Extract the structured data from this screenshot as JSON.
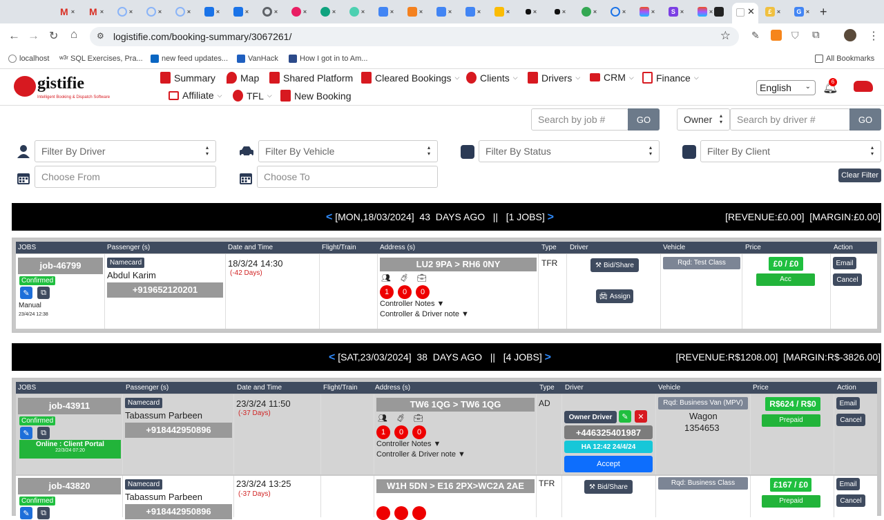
{
  "browser": {
    "url": "logistifie.com/booking-summary/3067261/",
    "bookmarks": [
      {
        "label": "localhost"
      },
      {
        "label": "SQL Exercises, Pra..."
      },
      {
        "label": "new feed updates..."
      },
      {
        "label": "VanHack"
      },
      {
        "label": "How I got in to Am..."
      }
    ],
    "all_bookmarks": "All Bookmarks"
  },
  "header": {
    "logo_text": "gistifie",
    "logo_tagline": "Intelligent Booking & Dispatch Software",
    "nav": [
      {
        "label": "Summary"
      },
      {
        "label": "Map"
      },
      {
        "label": "Shared Platform"
      },
      {
        "label": "Cleared Bookings"
      },
      {
        "label": "Clients"
      },
      {
        "label": "Drivers"
      },
      {
        "label": "CRM"
      },
      {
        "label": "Finance"
      },
      {
        "label": "Affiliate"
      },
      {
        "label": "TFL"
      },
      {
        "label": "New Booking"
      }
    ],
    "language": "English",
    "notification_count": "6"
  },
  "search": {
    "job_placeholder": "Search by job #",
    "go": "GO",
    "owner": "Owner",
    "driver_placeholder": "Search by driver #"
  },
  "filters": {
    "driver": "Filter By Driver",
    "vehicle": "Filter By Vehicle",
    "status": "Filter By Status",
    "client": "Filter By Client",
    "from": "Choose From",
    "to": "Choose To",
    "clear": "Clear Filter"
  },
  "columns1": {
    "jobs": "JOBS",
    "passenger": "Passenger (s)",
    "datetime": "Date and Time",
    "flight": "Flight/Train",
    "address": "Address (s)",
    "type": "Type",
    "driver": "Driver",
    "vehicle": "Vehicle",
    "price": "Price",
    "action": "Action"
  },
  "groups": [
    {
      "date": "[MON,18/03/2024]",
      "ago": "43  DAYS AGO",
      "sep": "||",
      "jobs": "[1 JOBS]",
      "revenue": "[REVENUE:£0.00]",
      "margin": "[MARGIN:£0.00]"
    },
    {
      "date": "[SAT,23/03/2024]",
      "ago": "38  DAYS AGO",
      "sep": "||",
      "jobs": "[4 JOBS]",
      "revenue": "[REVENUE:R$1208.00]",
      "margin": "[MARGIN:R$-3826.00]"
    }
  ],
  "jobs": [
    {
      "id": "job-46799",
      "status": "Confirmed",
      "source": "Manual",
      "created": "23/4/24 12:38",
      "namecard": "Namecard",
      "passenger": "Abdul Karim",
      "phone": "+919652120201",
      "datetime": "18/3/24 14:30",
      "days": "(-42 Days)",
      "address": "LU2 9PA > RH6 0NY",
      "counts": [
        "1",
        "0",
        "0"
      ],
      "notes1": "Controller Notes ▼",
      "notes2": "Controller & Driver note ▼",
      "type": "TFR",
      "bid": "Bid/Share",
      "assign": "Assign",
      "vehicle": "Rqd: Test Class",
      "price": "£0 / £0",
      "price_status": "Acc",
      "email": "Email",
      "cancel": "Cancel"
    },
    {
      "id": "job-43911",
      "status": "Confirmed",
      "source": "Online : Client Portal",
      "created": "22/3/24 07:20",
      "namecard": "Namecard",
      "passenger": "Tabassum Parbeen",
      "phone": "+918442950896",
      "datetime": "23/3/24 11:50",
      "days": "(-37 Days)",
      "address": "TW6 1QG > TW6 1QG",
      "counts": [
        "1",
        "0",
        "0"
      ],
      "notes1": "Controller Notes ▼",
      "notes2": "Controller & Driver note ▼",
      "type": "AD",
      "driver_label": "Owner Driver",
      "driver_phone": "+446325401987",
      "driver_ha": "HA 12:42 24/4/24",
      "accept": "Accept",
      "vehicle": "Rqd: Business Van (MPV)",
      "vehicle_name": "Wagon",
      "vehicle_no": "1354653",
      "price": "R$624 / R$0",
      "price_status": "Prepaid",
      "email": "Email",
      "cancel": "Cancel"
    },
    {
      "id": "job-43820",
      "status": "Confirmed",
      "namecard": "Namecard",
      "passenger": "Tabassum Parbeen",
      "phone": "+918442950896",
      "datetime": "23/3/24 13:25",
      "days": "(-37 Days)",
      "address": "W1H 5DN > E16 2PX>WC2A 2AE",
      "type": "TFR",
      "bid": "Bid/Share",
      "vehicle": "Rqd: Business Class",
      "price": "£167 / £0",
      "price_status": "Prepaid",
      "email": "Email",
      "cancel": "Cancel"
    }
  ],
  "colors": {
    "accent_green": "#1fbf3f",
    "brand_red": "#e00000",
    "dark_header": "#3f4b5f",
    "link_blue": "#2f8cff"
  }
}
